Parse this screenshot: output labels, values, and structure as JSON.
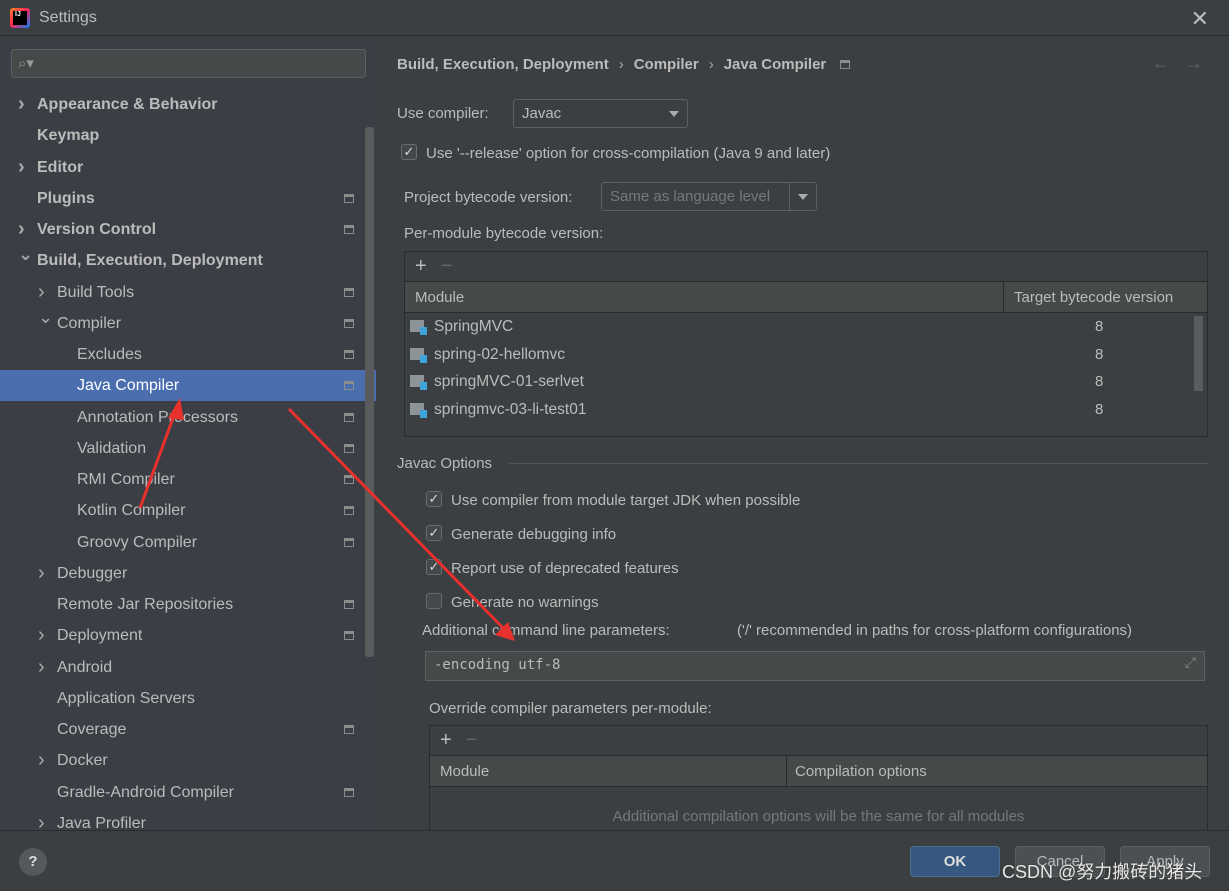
{
  "window": {
    "title": "Settings"
  },
  "search": {
    "placeholder": ""
  },
  "sidebar": {
    "items": [
      {
        "label": "Appearance & Behavior",
        "level": 0,
        "arrow": "right",
        "bold": true,
        "page": false
      },
      {
        "label": "Keymap",
        "level": 0,
        "arrow": "",
        "bold": true,
        "page": false
      },
      {
        "label": "Editor",
        "level": 0,
        "arrow": "right",
        "bold": true,
        "page": false
      },
      {
        "label": "Plugins",
        "level": 0,
        "arrow": "",
        "bold": true,
        "page": true
      },
      {
        "label": "Version Control",
        "level": 0,
        "arrow": "right",
        "bold": true,
        "page": true
      },
      {
        "label": "Build, Execution, Deployment",
        "level": 0,
        "arrow": "down",
        "bold": true,
        "page": false
      },
      {
        "label": "Build Tools",
        "level": 1,
        "arrow": "right",
        "page": true
      },
      {
        "label": "Compiler",
        "level": 1,
        "arrow": "down",
        "page": true
      },
      {
        "label": "Excludes",
        "level": 2,
        "arrow": "",
        "page": true
      },
      {
        "label": "Java Compiler",
        "level": 2,
        "arrow": "",
        "page": true,
        "selected": true
      },
      {
        "label": "Annotation Processors",
        "level": 2,
        "arrow": "",
        "page": true
      },
      {
        "label": "Validation",
        "level": 2,
        "arrow": "",
        "page": true
      },
      {
        "label": "RMI Compiler",
        "level": 2,
        "arrow": "",
        "page": true
      },
      {
        "label": "Kotlin Compiler",
        "level": 2,
        "arrow": "",
        "page": true
      },
      {
        "label": "Groovy Compiler",
        "level": 2,
        "arrow": "",
        "page": true
      },
      {
        "label": "Debugger",
        "level": 1,
        "arrow": "right",
        "page": false
      },
      {
        "label": "Remote Jar Repositories",
        "level": 1,
        "arrow": "",
        "page": true
      },
      {
        "label": "Deployment",
        "level": 1,
        "arrow": "right",
        "page": true
      },
      {
        "label": "Android",
        "level": 1,
        "arrow": "right",
        "page": false
      },
      {
        "label": "Application Servers",
        "level": 1,
        "arrow": "",
        "page": false
      },
      {
        "label": "Coverage",
        "level": 1,
        "arrow": "",
        "page": true
      },
      {
        "label": "Docker",
        "level": 1,
        "arrow": "right",
        "page": false
      },
      {
        "label": "Gradle-Android Compiler",
        "level": 1,
        "arrow": "",
        "page": true
      },
      {
        "label": "Java Profiler",
        "level": 1,
        "arrow": "right",
        "page": false
      }
    ]
  },
  "breadcrumb": [
    "Build, Execution, Deployment",
    "Compiler",
    "Java Compiler"
  ],
  "compiler": {
    "label": "Use compiler:",
    "value": "Javac"
  },
  "release_option": {
    "label": "Use '--release' option for cross-compilation (Java 9 and later)",
    "checked": true
  },
  "project_bytecode": {
    "label": "Project bytecode version:",
    "value": "Same as language level"
  },
  "per_module": {
    "label": "Per-module bytecode version:",
    "add": "+",
    "remove": "−",
    "columns": [
      "Module",
      "Target bytecode version"
    ],
    "rows": [
      {
        "module": "SpringMVC",
        "version": "8"
      },
      {
        "module": "spring-02-hellomvc",
        "version": "8"
      },
      {
        "module": "springMVC-01-serlvet",
        "version": "8"
      },
      {
        "module": "springmvc-03-li-test01",
        "version": "8"
      }
    ]
  },
  "javac": {
    "section": "Javac Options",
    "options": [
      {
        "label": "Use compiler from module target JDK when possible",
        "checked": true
      },
      {
        "label": "Generate debugging info",
        "checked": true
      },
      {
        "label": "Report use of deprecated features",
        "checked": true
      },
      {
        "label": "Generate no warnings",
        "checked": false
      }
    ],
    "params_label": "Additional command line parameters:",
    "params_hint": "('/' recommended in paths for cross-platform configurations)",
    "params_value": "-encoding utf-8",
    "override_label": "Override compiler parameters per-module:",
    "override_columns": [
      "Module",
      "Compilation options"
    ],
    "override_empty": "Additional compilation options will be the same for all modules"
  },
  "footer": {
    "help": "?",
    "ok": "OK",
    "cancel": "Cancel",
    "apply": "Apply"
  },
  "watermark": "CSDN @努力搬砖的猪头",
  "colors": {
    "selection": "#4b6eaf",
    "ok_button": "#365880",
    "annotation_arrow": "#e8302c"
  }
}
